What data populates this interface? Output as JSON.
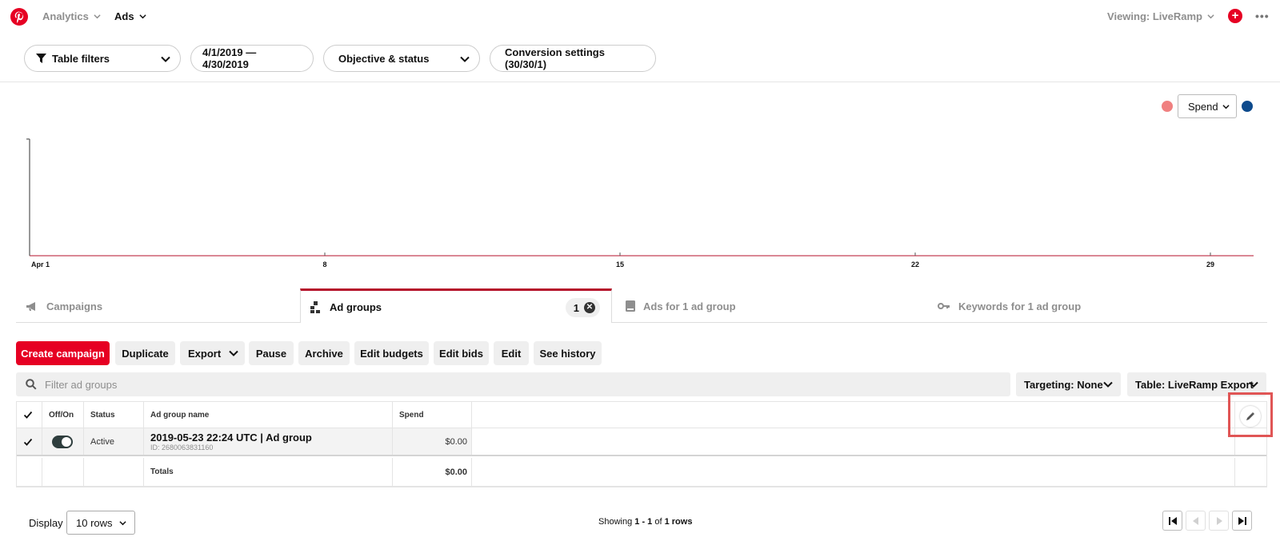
{
  "nav": {
    "analytics": "Analytics",
    "ads": "Ads",
    "viewing": "Viewing: LiveRamp"
  },
  "filters": {
    "table_filters": "Table filters",
    "date_range": "4/1/2019 — 4/30/2019",
    "objective_status": "Objective & status",
    "conversion_settings": "Conversion settings (30/30/1)"
  },
  "chart": {
    "metric": "Spend",
    "legend_colors": [
      "#f08080",
      "#0d4a8c"
    ],
    "axis_color": "#b5122b"
  },
  "chart_data": {
    "type": "line",
    "x_ticks": [
      "Apr 1",
      "8",
      "15",
      "22",
      "29"
    ],
    "series": []
  },
  "tabs": [
    {
      "label": "Campaigns",
      "icon": "megaphone-icon"
    },
    {
      "label": "Ad groups",
      "icon": "ad-groups-icon",
      "badge": "1"
    },
    {
      "label": "Ads for 1 ad group",
      "icon": "ad-icon"
    },
    {
      "label": "Keywords for 1 ad group",
      "icon": "key-icon"
    }
  ],
  "actions": {
    "create_campaign": "Create campaign",
    "duplicate": "Duplicate",
    "export": "Export",
    "pause": "Pause",
    "archive": "Archive",
    "edit_budgets": "Edit budgets",
    "edit_bids": "Edit bids",
    "edit": "Edit",
    "see_history": "See history"
  },
  "search": {
    "placeholder": "Filter ad groups"
  },
  "dropdowns": {
    "targeting": "Targeting: None",
    "table": "Table: LiveRamp Export"
  },
  "table": {
    "headers": {
      "off_on": "Off/On",
      "status": "Status",
      "ad_group_name": "Ad group name",
      "spend": "Spend"
    },
    "rows": [
      {
        "status": "Active",
        "name": "2019-05-23 22:24 UTC | Ad group",
        "id": "ID: 2680063831160",
        "spend": "$0.00"
      }
    ],
    "totals": {
      "label": "Totals",
      "spend": "$0.00"
    }
  },
  "footer": {
    "display_label": "Display",
    "rows_option": "10 rows",
    "showing_prefix": "Showing",
    "showing_range": "1 - 1",
    "showing_of": "of",
    "showing_total": "1 rows"
  }
}
